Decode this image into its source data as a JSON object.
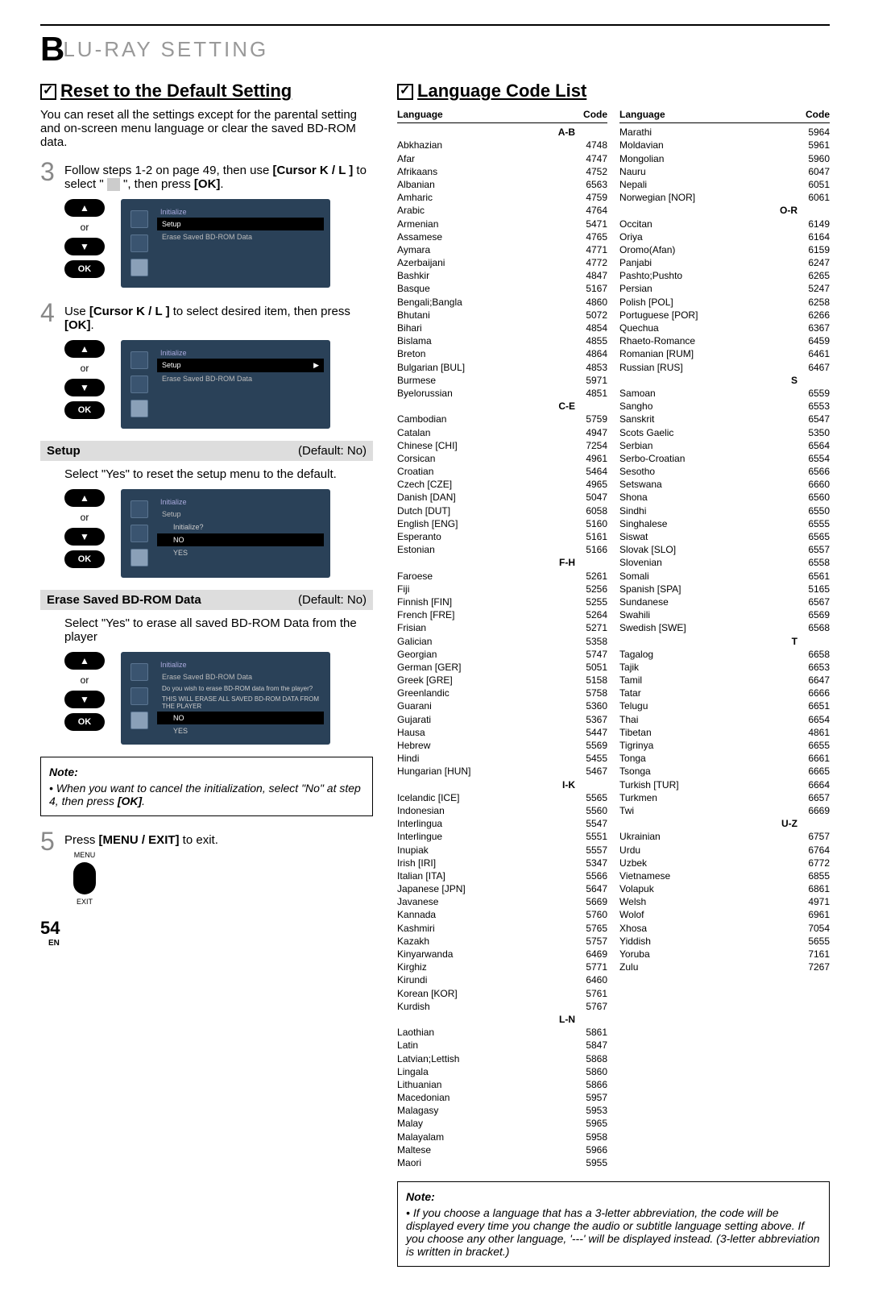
{
  "header": "LU-RAY  SETTING",
  "headerPrefix": "B",
  "pageNumber": "54",
  "pageLang": "EN",
  "left": {
    "title": "Reset to the Default Setting",
    "intro": "You can reset all the settings except for the parental setting and on-screen menu language or clear the saved BD-ROM data.",
    "step3Prefix": "Follow steps 1-2 on page 49, then use ",
    "step3Cursor": "[Cursor K / L ]",
    "step3Mid": " to select \" ",
    "step3End": " \", then press ",
    "ok": "[OK]",
    "or": "or",
    "osd1_title": "Initialize",
    "osd1_setup": "Setup",
    "osd1_erase": "Erase Saved BD-ROM Data",
    "step4Prefix": "Use ",
    "step4Cursor": "[Cursor K / L ]",
    "step4End": " to select desired item, then press ",
    "setup_label": "Setup",
    "setup_default": "(Default: No)",
    "setup_desc": "Select \"Yes\" to reset the setup menu to the default.",
    "osd3_init": "Initialize?",
    "osd_no": "NO",
    "osd_yes": "YES",
    "erase_label": "Erase Saved BD-ROM Data",
    "erase_default": "(Default: No)",
    "erase_desc": "Select \"Yes\" to erase all saved BD-ROM Data from the player",
    "osd4_q1": "Do you wish to erase BD-ROM data from the player?",
    "osd4_q2": "THIS WILL ERASE ALL SAVED BD-ROM DATA FROM THE PLAYER",
    "note_title": "Note:",
    "note_text": "When you want to cancel the initialization, select \"No\" at step 4, then press ",
    "step5Prefix": "Press ",
    "step5Btn": "[MENU / EXIT]",
    "step5End": " to exit.",
    "menu_lbl_top": "MENU",
    "menu_lbl_bot": "EXIT"
  },
  "right": {
    "title": "Language Code List",
    "head_lang": "Language",
    "head_code": "Code",
    "note_title": "Note:",
    "note_text": "If you choose a language that has a 3-letter abbreviation, the code will be displayed every time you change the audio or subtitle language setting above. If you choose any other language, '---' will be displayed instead. (3-letter abbreviation is written in bracket.)",
    "sections_col1": [
      {
        "letter": "A-B",
        "rows": [
          [
            "Abkhazian",
            "4748"
          ],
          [
            "Afar",
            "4747"
          ],
          [
            "Afrikaans",
            "4752"
          ],
          [
            "Albanian",
            "6563"
          ],
          [
            "Amharic",
            "4759"
          ],
          [
            "Arabic",
            "4764"
          ],
          [
            "Armenian",
            "5471"
          ],
          [
            "Assamese",
            "4765"
          ],
          [
            "Aymara",
            "4771"
          ],
          [
            "Azerbaijani",
            "4772"
          ],
          [
            "Bashkir",
            "4847"
          ],
          [
            "Basque",
            "5167"
          ],
          [
            "Bengali;Bangla",
            "4860"
          ],
          [
            "Bhutani",
            "5072"
          ],
          [
            "Bihari",
            "4854"
          ],
          [
            "Bislama",
            "4855"
          ],
          [
            "Breton",
            "4864"
          ],
          [
            "Bulgarian [BUL]",
            "4853"
          ],
          [
            "Burmese",
            "5971"
          ],
          [
            "Byelorussian",
            "4851"
          ]
        ]
      },
      {
        "letter": "C-E",
        "rows": [
          [
            "Cambodian",
            "5759"
          ],
          [
            "Catalan",
            "4947"
          ],
          [
            "Chinese [CHI]",
            "7254"
          ],
          [
            "Corsican",
            "4961"
          ],
          [
            "Croatian",
            "5464"
          ],
          [
            "Czech [CZE]",
            "4965"
          ],
          [
            "Danish [DAN]",
            "5047"
          ],
          [
            "Dutch [DUT]",
            "6058"
          ],
          [
            "English [ENG]",
            "5160"
          ],
          [
            "Esperanto",
            "5161"
          ],
          [
            "Estonian",
            "5166"
          ]
        ]
      },
      {
        "letter": "F-H",
        "rows": [
          [
            "Faroese",
            "5261"
          ],
          [
            "Fiji",
            "5256"
          ],
          [
            "Finnish [FIN]",
            "5255"
          ],
          [
            "French [FRE]",
            "5264"
          ],
          [
            "Frisian",
            "5271"
          ],
          [
            "Galician",
            "5358"
          ],
          [
            "Georgian",
            "5747"
          ],
          [
            "German [GER]",
            "5051"
          ],
          [
            "Greek [GRE]",
            "5158"
          ],
          [
            "Greenlandic",
            "5758"
          ],
          [
            "Guarani",
            "5360"
          ],
          [
            "Gujarati",
            "5367"
          ],
          [
            "Hausa",
            "5447"
          ],
          [
            "Hebrew",
            "5569"
          ],
          [
            "Hindi",
            "5455"
          ],
          [
            "Hungarian [HUN]",
            "5467"
          ]
        ]
      },
      {
        "letter": "I-K",
        "rows": [
          [
            "Icelandic [ICE]",
            "5565"
          ],
          [
            "Indonesian",
            "5560"
          ],
          [
            "Interlingua",
            "5547"
          ],
          [
            "Interlingue",
            "5551"
          ],
          [
            "Inupiak",
            "5557"
          ],
          [
            "Irish [IRI]",
            "5347"
          ],
          [
            "Italian [ITA]",
            "5566"
          ],
          [
            "Japanese [JPN]",
            "5647"
          ],
          [
            "Javanese",
            "5669"
          ],
          [
            "Kannada",
            "5760"
          ],
          [
            "Kashmiri",
            "5765"
          ],
          [
            "Kazakh",
            "5757"
          ],
          [
            "Kinyarwanda",
            "6469"
          ],
          [
            "Kirghiz",
            "5771"
          ],
          [
            "Kirundi",
            "6460"
          ],
          [
            "Korean [KOR]",
            "5761"
          ],
          [
            "Kurdish",
            "5767"
          ]
        ]
      },
      {
        "letter": "L-N",
        "rows": [
          [
            "Laothian",
            "5861"
          ],
          [
            "Latin",
            "5847"
          ],
          [
            "Latvian;Lettish",
            "5868"
          ],
          [
            "Lingala",
            "5860"
          ],
          [
            "Lithuanian",
            "5866"
          ],
          [
            "Macedonian",
            "5957"
          ],
          [
            "Malagasy",
            "5953"
          ],
          [
            "Malay",
            "5965"
          ],
          [
            "Malayalam",
            "5958"
          ],
          [
            "Maltese",
            "5966"
          ],
          [
            "Maori",
            "5955"
          ]
        ]
      }
    ],
    "sections_col2": [
      {
        "letter": "",
        "rows": [
          [
            "Marathi",
            "5964"
          ],
          [
            "Moldavian",
            "5961"
          ],
          [
            "Mongolian",
            "5960"
          ],
          [
            "Nauru",
            "6047"
          ],
          [
            "Nepali",
            "6051"
          ],
          [
            "Norwegian [NOR]",
            "6061"
          ]
        ]
      },
      {
        "letter": "O-R",
        "rows": [
          [
            "Occitan",
            "6149"
          ],
          [
            "Oriya",
            "6164"
          ],
          [
            "Oromo(Afan)",
            "6159"
          ],
          [
            "Panjabi",
            "6247"
          ],
          [
            "Pashto;Pushto",
            "6265"
          ],
          [
            "Persian",
            "5247"
          ],
          [
            "Polish [POL]",
            "6258"
          ],
          [
            "Portuguese [POR]",
            "6266"
          ],
          [
            "Quechua",
            "6367"
          ],
          [
            "Rhaeto-Romance",
            "6459"
          ],
          [
            "Romanian [RUM]",
            "6461"
          ],
          [
            "Russian [RUS]",
            "6467"
          ]
        ]
      },
      {
        "letter": "S",
        "rows": [
          [
            "Samoan",
            "6559"
          ],
          [
            "Sangho",
            "6553"
          ],
          [
            "Sanskrit",
            "6547"
          ],
          [
            "Scots Gaelic",
            "5350"
          ],
          [
            "Serbian",
            "6564"
          ],
          [
            "Serbo-Croatian",
            "6554"
          ],
          [
            "Sesotho",
            "6566"
          ],
          [
            "Setswana",
            "6660"
          ],
          [
            "Shona",
            "6560"
          ],
          [
            "Sindhi",
            "6550"
          ],
          [
            "Singhalese",
            "6555"
          ],
          [
            "Siswat",
            "6565"
          ],
          [
            "Slovak [SLO]",
            "6557"
          ],
          [
            "Slovenian",
            "6558"
          ],
          [
            "Somali",
            "6561"
          ],
          [
            "Spanish [SPA]",
            "5165"
          ],
          [
            "Sundanese",
            "6567"
          ],
          [
            "Swahili",
            "6569"
          ],
          [
            "Swedish [SWE]",
            "6568"
          ]
        ]
      },
      {
        "letter": "T",
        "rows": [
          [
            "Tagalog",
            "6658"
          ],
          [
            "Tajik",
            "6653"
          ],
          [
            "Tamil",
            "6647"
          ],
          [
            "Tatar",
            "6666"
          ],
          [
            "Telugu",
            "6651"
          ],
          [
            "Thai",
            "6654"
          ],
          [
            "Tibetan",
            "4861"
          ],
          [
            "Tigrinya",
            "6655"
          ],
          [
            "Tonga",
            "6661"
          ],
          [
            "Tsonga",
            "6665"
          ],
          [
            "Turkish [TUR]",
            "6664"
          ],
          [
            "Turkmen",
            "6657"
          ],
          [
            "Twi",
            "6669"
          ]
        ]
      },
      {
        "letter": "U-Z",
        "rows": [
          [
            "Ukrainian",
            "6757"
          ],
          [
            "Urdu",
            "6764"
          ],
          [
            "Uzbek",
            "6772"
          ],
          [
            "Vietnamese",
            "6855"
          ],
          [
            "Volapuk",
            "6861"
          ],
          [
            "Welsh",
            "4971"
          ],
          [
            "Wolof",
            "6961"
          ],
          [
            "Xhosa",
            "7054"
          ],
          [
            "Yiddish",
            "5655"
          ],
          [
            "Yoruba",
            "7161"
          ],
          [
            "Zulu",
            "7267"
          ]
        ]
      }
    ]
  }
}
